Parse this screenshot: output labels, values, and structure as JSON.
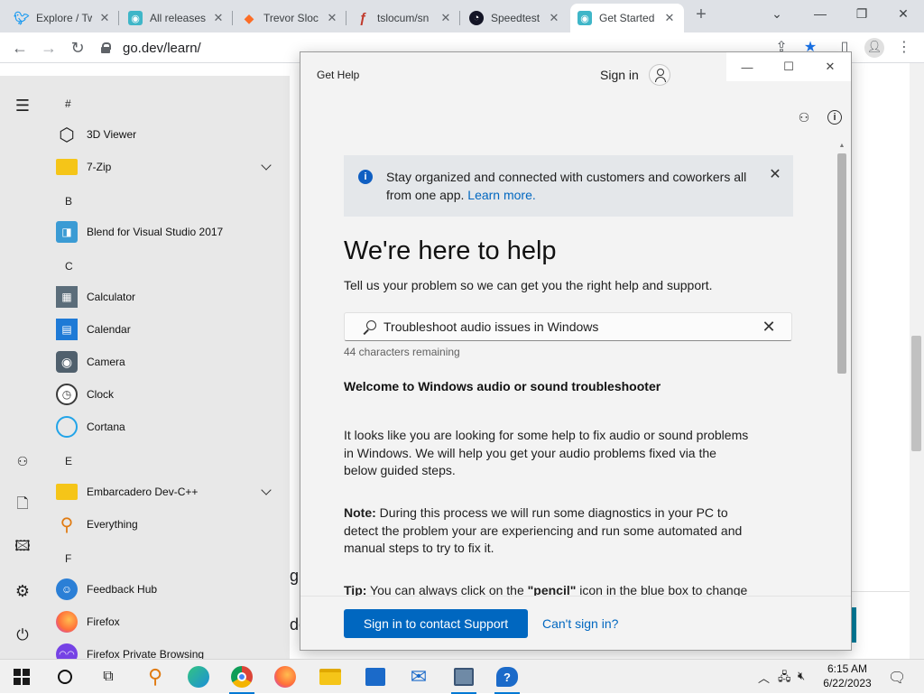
{
  "browser": {
    "tabs": [
      {
        "title": "Explore / Tw",
        "icon": "twitter-icon",
        "color": "#1d9bf0",
        "glyph": "t"
      },
      {
        "title": "All releases",
        "icon": "go-gopher-icon",
        "color": "#3fb6c8",
        "glyph": "g"
      },
      {
        "title": "Trevor Sloc",
        "icon": "gitlab-icon",
        "color": "#fc6d26",
        "glyph": "▲"
      },
      {
        "title": "tslocum/sn",
        "icon": "sourcehut-icon",
        "color": "#ffffff",
        "glyph": "f"
      },
      {
        "title": "Speedtest (",
        "icon": "speedtest-icon",
        "color": "#141526",
        "glyph": "◔"
      },
      {
        "title": "Get Started",
        "icon": "go-gopher-icon",
        "color": "#3fb6c8",
        "glyph": "g"
      }
    ],
    "url": "go.dev/learn/",
    "new_tab": "+",
    "controls": {
      "dropdown": "⌄",
      "minimize": "—",
      "maximize": "❐",
      "close": "✕"
    }
  },
  "background_page": {
    "fragment_1": "g",
    "fragment_2": "de"
  },
  "start_menu": {
    "rail": [
      "menu-icon",
      "user-icon",
      "documents-icon",
      "pictures-icon",
      "settings-icon",
      "power-icon"
    ],
    "groups": [
      {
        "letter": "#",
        "apps": [
          {
            "label": "3D Viewer",
            "icon": "cube-icon",
            "color": "#ffffff",
            "expand": false
          },
          {
            "label": "7-Zip",
            "icon": "folder-icon",
            "color": "#f5c518",
            "expand": true
          }
        ]
      },
      {
        "letter": "B",
        "apps": [
          {
            "label": "Blend for Visual Studio 2017",
            "icon": "blend-icon",
            "color": "#3b9bd4",
            "expand": false
          }
        ]
      },
      {
        "letter": "C",
        "apps": [
          {
            "label": "Calculator",
            "icon": "calculator-icon",
            "color": "#5b6d7a",
            "expand": false
          },
          {
            "label": "Calendar",
            "icon": "calendar-icon",
            "color": "#1e7ad6",
            "expand": false
          },
          {
            "label": "Camera",
            "icon": "camera-icon",
            "color": "#50606d",
            "expand": false
          },
          {
            "label": "Clock",
            "icon": "clock-icon",
            "color": "#3a3a3a",
            "expand": false
          },
          {
            "label": "Cortana",
            "icon": "cortana-icon",
            "color": "#22a4e8",
            "expand": false
          }
        ]
      },
      {
        "letter": "E",
        "apps": [
          {
            "label": "Embarcadero Dev-C++",
            "icon": "folder-icon",
            "color": "#f5c518",
            "expand": true
          },
          {
            "label": "Everything",
            "icon": "magnifier-icon",
            "color": "#e07b12",
            "expand": false
          }
        ]
      },
      {
        "letter": "F",
        "apps": [
          {
            "label": "Feedback Hub",
            "icon": "feedback-hub-icon",
            "color": "#2b7fd6",
            "expand": false
          },
          {
            "label": "Firefox",
            "icon": "firefox-icon",
            "color": "#ff7139",
            "expand": false
          },
          {
            "label": "Firefox Private Browsing",
            "icon": "firefox-private-icon",
            "color": "#7542e5",
            "expand": false
          }
        ]
      }
    ]
  },
  "get_help": {
    "window_title": "Get Help",
    "sign_in": "Sign in",
    "banner_text": "Stay organized and connected with customers and coworkers all from one app.",
    "banner_link": "Learn more.",
    "headline": "We're here to help",
    "subline": "Tell us your problem so we can get you the right help and support.",
    "search_value": "Troubleshoot audio issues in Windows",
    "remaining": "44 characters remaining",
    "content_title": "Welcome to Windows audio or sound troubleshooter",
    "para1": "It looks like you are looking for some help to fix audio or sound problems in Windows. We will help you get your audio problems fixed via the below guided steps.",
    "para2_label": "Note:",
    "para2": " During this process we will run some diagnostics in your PC to detect the problem your are experiencing and run some automated  and manual steps to try to fix it.",
    "para3_label": "Tip:",
    "para3_a": " You can always click on the ",
    "para3_bold": "\"pencil\"",
    "para3_b": " icon in the blue box to change",
    "primary_button": "Sign in to contact Support",
    "secondary_link": "Can't sign in?"
  },
  "taskbar": {
    "items": [
      "windows-start-icon",
      "cortana-search-icon",
      "task-view-icon",
      "everything-app-icon",
      "edge-icon",
      "chrome-icon",
      "firefox-icon",
      "file-explorer-icon",
      "store-icon",
      "mail-icon",
      "network-tool-icon",
      "get-help-icon"
    ],
    "time": "6:15 AM",
    "date": "6/22/2023"
  }
}
